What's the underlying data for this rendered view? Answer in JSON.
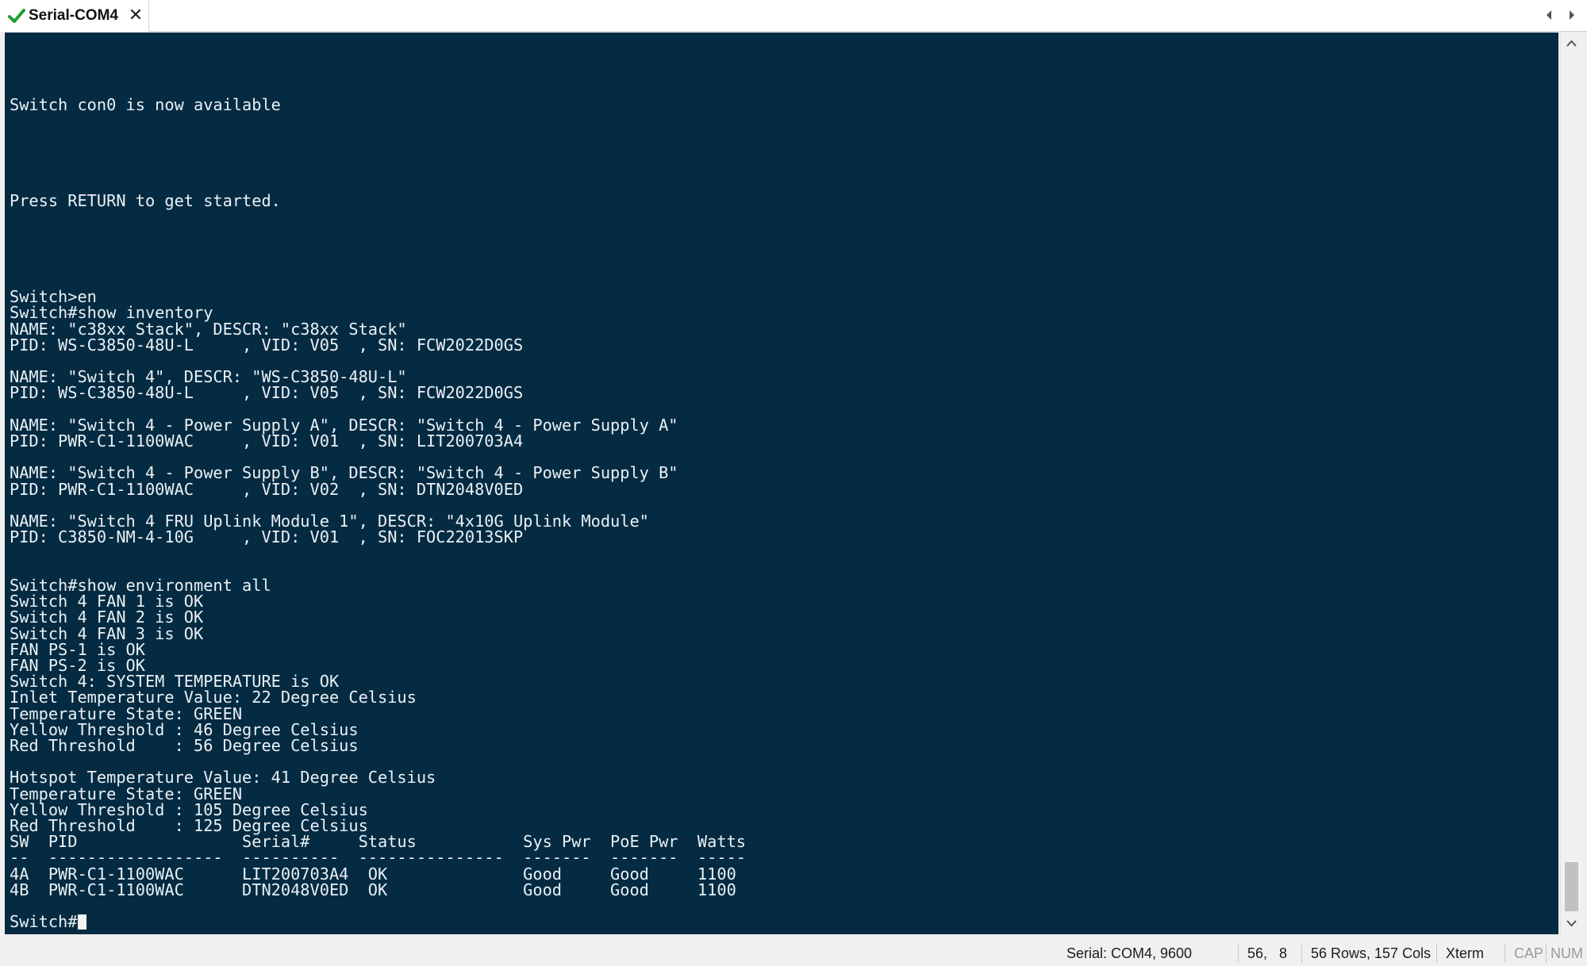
{
  "tab": {
    "title": "Serial-COM4",
    "check_icon": "check-icon",
    "close_icon": "close-icon",
    "status_color": "#1e9e2e"
  },
  "colors": {
    "terminal_bg": "#052b42",
    "terminal_fg": "#eaf1f5"
  },
  "terminal": {
    "lines": [
      "",
      "",
      "",
      "",
      "Switch con0 is now available",
      "",
      "",
      "",
      "",
      "",
      "Press RETURN to get started.",
      "",
      "",
      "",
      "",
      "",
      "Switch>en",
      "Switch#show inventory",
      "NAME: \"c38xx Stack\", DESCR: \"c38xx Stack\"",
      "PID: WS-C3850-48U-L     , VID: V05  , SN: FCW2022D0GS",
      "",
      "NAME: \"Switch 4\", DESCR: \"WS-C3850-48U-L\"",
      "PID: WS-C3850-48U-L     , VID: V05  , SN: FCW2022D0GS",
      "",
      "NAME: \"Switch 4 - Power Supply A\", DESCR: \"Switch 4 - Power Supply A\"",
      "PID: PWR-C1-1100WAC     , VID: V01  , SN: LIT200703A4",
      "",
      "NAME: \"Switch 4 - Power Supply B\", DESCR: \"Switch 4 - Power Supply B\"",
      "PID: PWR-C1-1100WAC     , VID: V02  , SN: DTN2048V0ED",
      "",
      "NAME: \"Switch 4 FRU Uplink Module 1\", DESCR: \"4x10G Uplink Module\"",
      "PID: C3850-NM-4-10G     , VID: V01  , SN: FOC22013SKP",
      "",
      "",
      "Switch#show environment all",
      "Switch 4 FAN 1 is OK",
      "Switch 4 FAN 2 is OK",
      "Switch 4 FAN 3 is OK",
      "FAN PS-1 is OK",
      "FAN PS-2 is OK",
      "Switch 4: SYSTEM TEMPERATURE is OK",
      "Inlet Temperature Value: 22 Degree Celsius",
      "Temperature State: GREEN",
      "Yellow Threshold : 46 Degree Celsius",
      "Red Threshold    : 56 Degree Celsius",
      "",
      "Hotspot Temperature Value: 41 Degree Celsius",
      "Temperature State: GREEN",
      "Yellow Threshold : 105 Degree Celsius",
      "Red Threshold    : 125 Degree Celsius",
      "SW  PID                 Serial#     Status           Sys Pwr  PoE Pwr  Watts",
      "--  ------------------  ----------  ---------------  -------  -------  -----",
      "4A  PWR-C1-1100WAC      LIT200703A4  OK              Good     Good     1100",
      "4B  PWR-C1-1100WAC      DTN2048V0ED  OK              Good     Good     1100",
      ""
    ],
    "prompt": "Switch#"
  },
  "scrollbar": {
    "up_icon": "scroll-up-arrow-icon",
    "down_icon": "scroll-down-arrow-icon",
    "position": 0.96
  },
  "statusbar": {
    "connection": "Serial: COM4, 9600",
    "cursor_row": "56,",
    "cursor_col": "8",
    "dimensions": "56 Rows, 157 Cols",
    "terminal_type": "Xterm",
    "cap": "CAP",
    "num": "NUM"
  }
}
